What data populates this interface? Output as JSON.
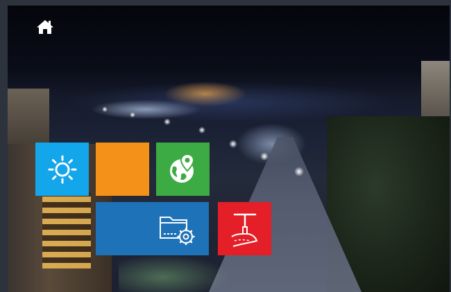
{
  "colors": {
    "frame_bg": "#2d333c",
    "tile_sun": "#13a6ea",
    "tile_orange": "#f39118",
    "tile_map": "#3dab44",
    "tile_folder": "#1e72b8",
    "tile_street": "#e51f28",
    "icon": "#ffffff"
  },
  "header": {
    "home_icon": "home-icon"
  },
  "tiles": [
    {
      "icon": "sun-icon"
    },
    {
      "icon": ""
    },
    {
      "icon": "globe-map-pin-icon"
    },
    {
      "icon": "folder-settings-icon"
    },
    {
      "icon": "street-lamp-road-icon"
    }
  ]
}
